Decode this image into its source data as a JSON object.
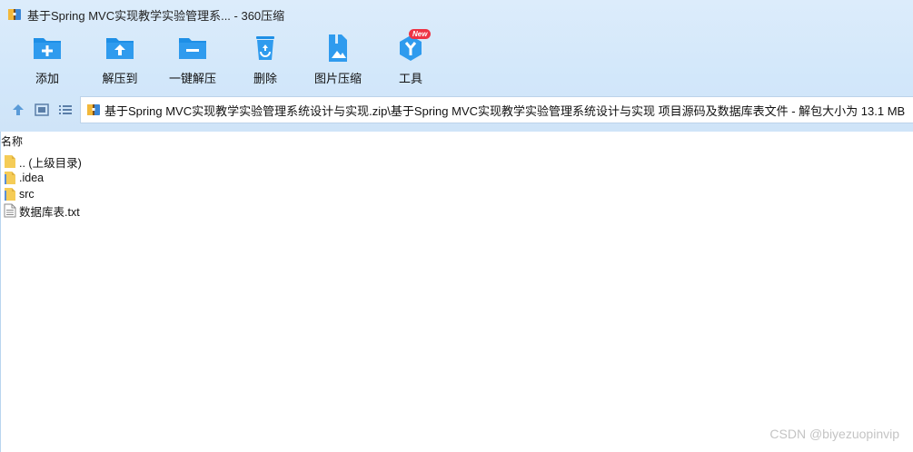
{
  "window": {
    "title": "基于Spring MVC实现教学实验管理系... - 360压缩",
    "app_icon": "archive-app-icon"
  },
  "toolbar": {
    "items": [
      {
        "label": "添加",
        "icon": "add-folder-icon"
      },
      {
        "label": "解压到",
        "icon": "extract-to-icon"
      },
      {
        "label": "一键解压",
        "icon": "one-click-extract-icon"
      },
      {
        "label": "删除",
        "icon": "recycle-bin-icon"
      },
      {
        "label": "图片压缩",
        "icon": "image-compress-icon"
      },
      {
        "label": "工具",
        "icon": "tools-icon",
        "badge": "New"
      }
    ]
  },
  "nav": {
    "buttons": [
      "up-arrow-icon",
      "thumbnail-view-icon",
      "list-view-icon"
    ]
  },
  "address": {
    "path": "基于Spring MVC实现教学实验管理系统设计与实现.zip\\基于Spring MVC实现教学实验管理系统设计与实现 项目源码及数据库表文件 - 解包大小为 13.1 MB"
  },
  "file_list": {
    "column_header": "名称",
    "rows": [
      {
        "name": ".. (上级目录)",
        "type": "folder-up"
      },
      {
        "name": ".idea",
        "type": "folder"
      },
      {
        "name": "src",
        "type": "folder"
      },
      {
        "name": "数据库表.txt",
        "type": "text-file"
      }
    ]
  },
  "watermark": "CSDN @biyezuopinvip",
  "colors": {
    "toolbar_bg": "#d6e9fb",
    "icon_blue": "#1e8fe6",
    "badge_red": "#ee3344",
    "folder_yellow": "#f5cc57"
  }
}
